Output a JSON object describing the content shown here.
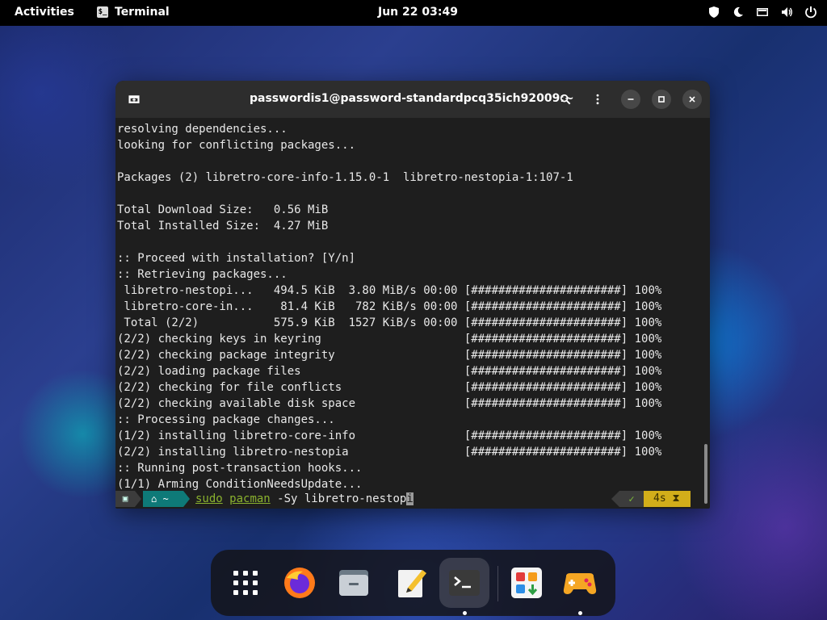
{
  "topbar": {
    "activities": "Activities",
    "app_name": "Terminal",
    "app_icon": "$_",
    "clock": "Jun 22  03:49",
    "tray_icons": [
      "shield-icon",
      "moon-icon",
      "screen-icon",
      "volume-icon",
      "power-icon"
    ]
  },
  "window": {
    "title": "passwordis1@password-standardpcq35ich92009:~",
    "buttons": [
      "new-tab-icon",
      "search-icon",
      "menu-icon",
      "minimize-icon",
      "maximize-icon",
      "close-icon"
    ]
  },
  "terminal": {
    "lines": [
      "resolving dependencies...",
      "looking for conflicting packages...",
      "",
      "Packages (2) libretro-core-info-1.15.0-1  libretro-nestopia-1:107-1",
      "",
      "Total Download Size:   0.56 MiB",
      "Total Installed Size:  4.27 MiB",
      "",
      ":: Proceed with installation? [Y/n]",
      ":: Retrieving packages...",
      " libretro-nestopi...   494.5 KiB  3.80 MiB/s 00:00 [######################] 100%",
      " libretro-core-in...    81.4 KiB   782 KiB/s 00:00 [######################] 100%",
      " Total (2/2)           575.9 KiB  1527 KiB/s 00:00 [######################] 100%",
      "(2/2) checking keys in keyring                     [######################] 100%",
      "(2/2) checking package integrity                   [######################] 100%",
      "(2/2) loading package files                        [######################] 100%",
      "(2/2) checking for file conflicts                  [######################] 100%",
      "(2/2) checking available disk space                [######################] 100%",
      ":: Processing package changes...",
      "(1/2) installing libretro-core-info                [######################] 100%",
      "(2/2) installing libretro-nestopia                 [######################] 100%",
      ":: Running post-transaction hooks...",
      "(1/1) Arming ConditionNeedsUpdate..."
    ],
    "prompt": {
      "dir": "~",
      "cmd_sudo": "sudo",
      "cmd_pacman": "pacman",
      "cmd_rest": " -Sy libretro-nestop",
      "cmd_cursor": "i",
      "status_ok": "✓",
      "duration": "4s"
    }
  },
  "dock": {
    "items": [
      {
        "name": "app-grid-icon",
        "active": false
      },
      {
        "name": "firefox-icon",
        "active": false
      },
      {
        "name": "files-icon",
        "active": false
      },
      {
        "name": "text-editor-icon",
        "active": false
      },
      {
        "name": "terminal-icon",
        "active": true
      },
      {
        "name": "software-icon",
        "active": false
      },
      {
        "name": "games-icon",
        "active": false
      }
    ]
  },
  "colors": {
    "prompt_dir_bg": "#0e7a78",
    "prompt_time_bg": "#d2ae1a",
    "cmd_green": "#8ab22e",
    "terminal_bg": "#1e1e1e"
  }
}
